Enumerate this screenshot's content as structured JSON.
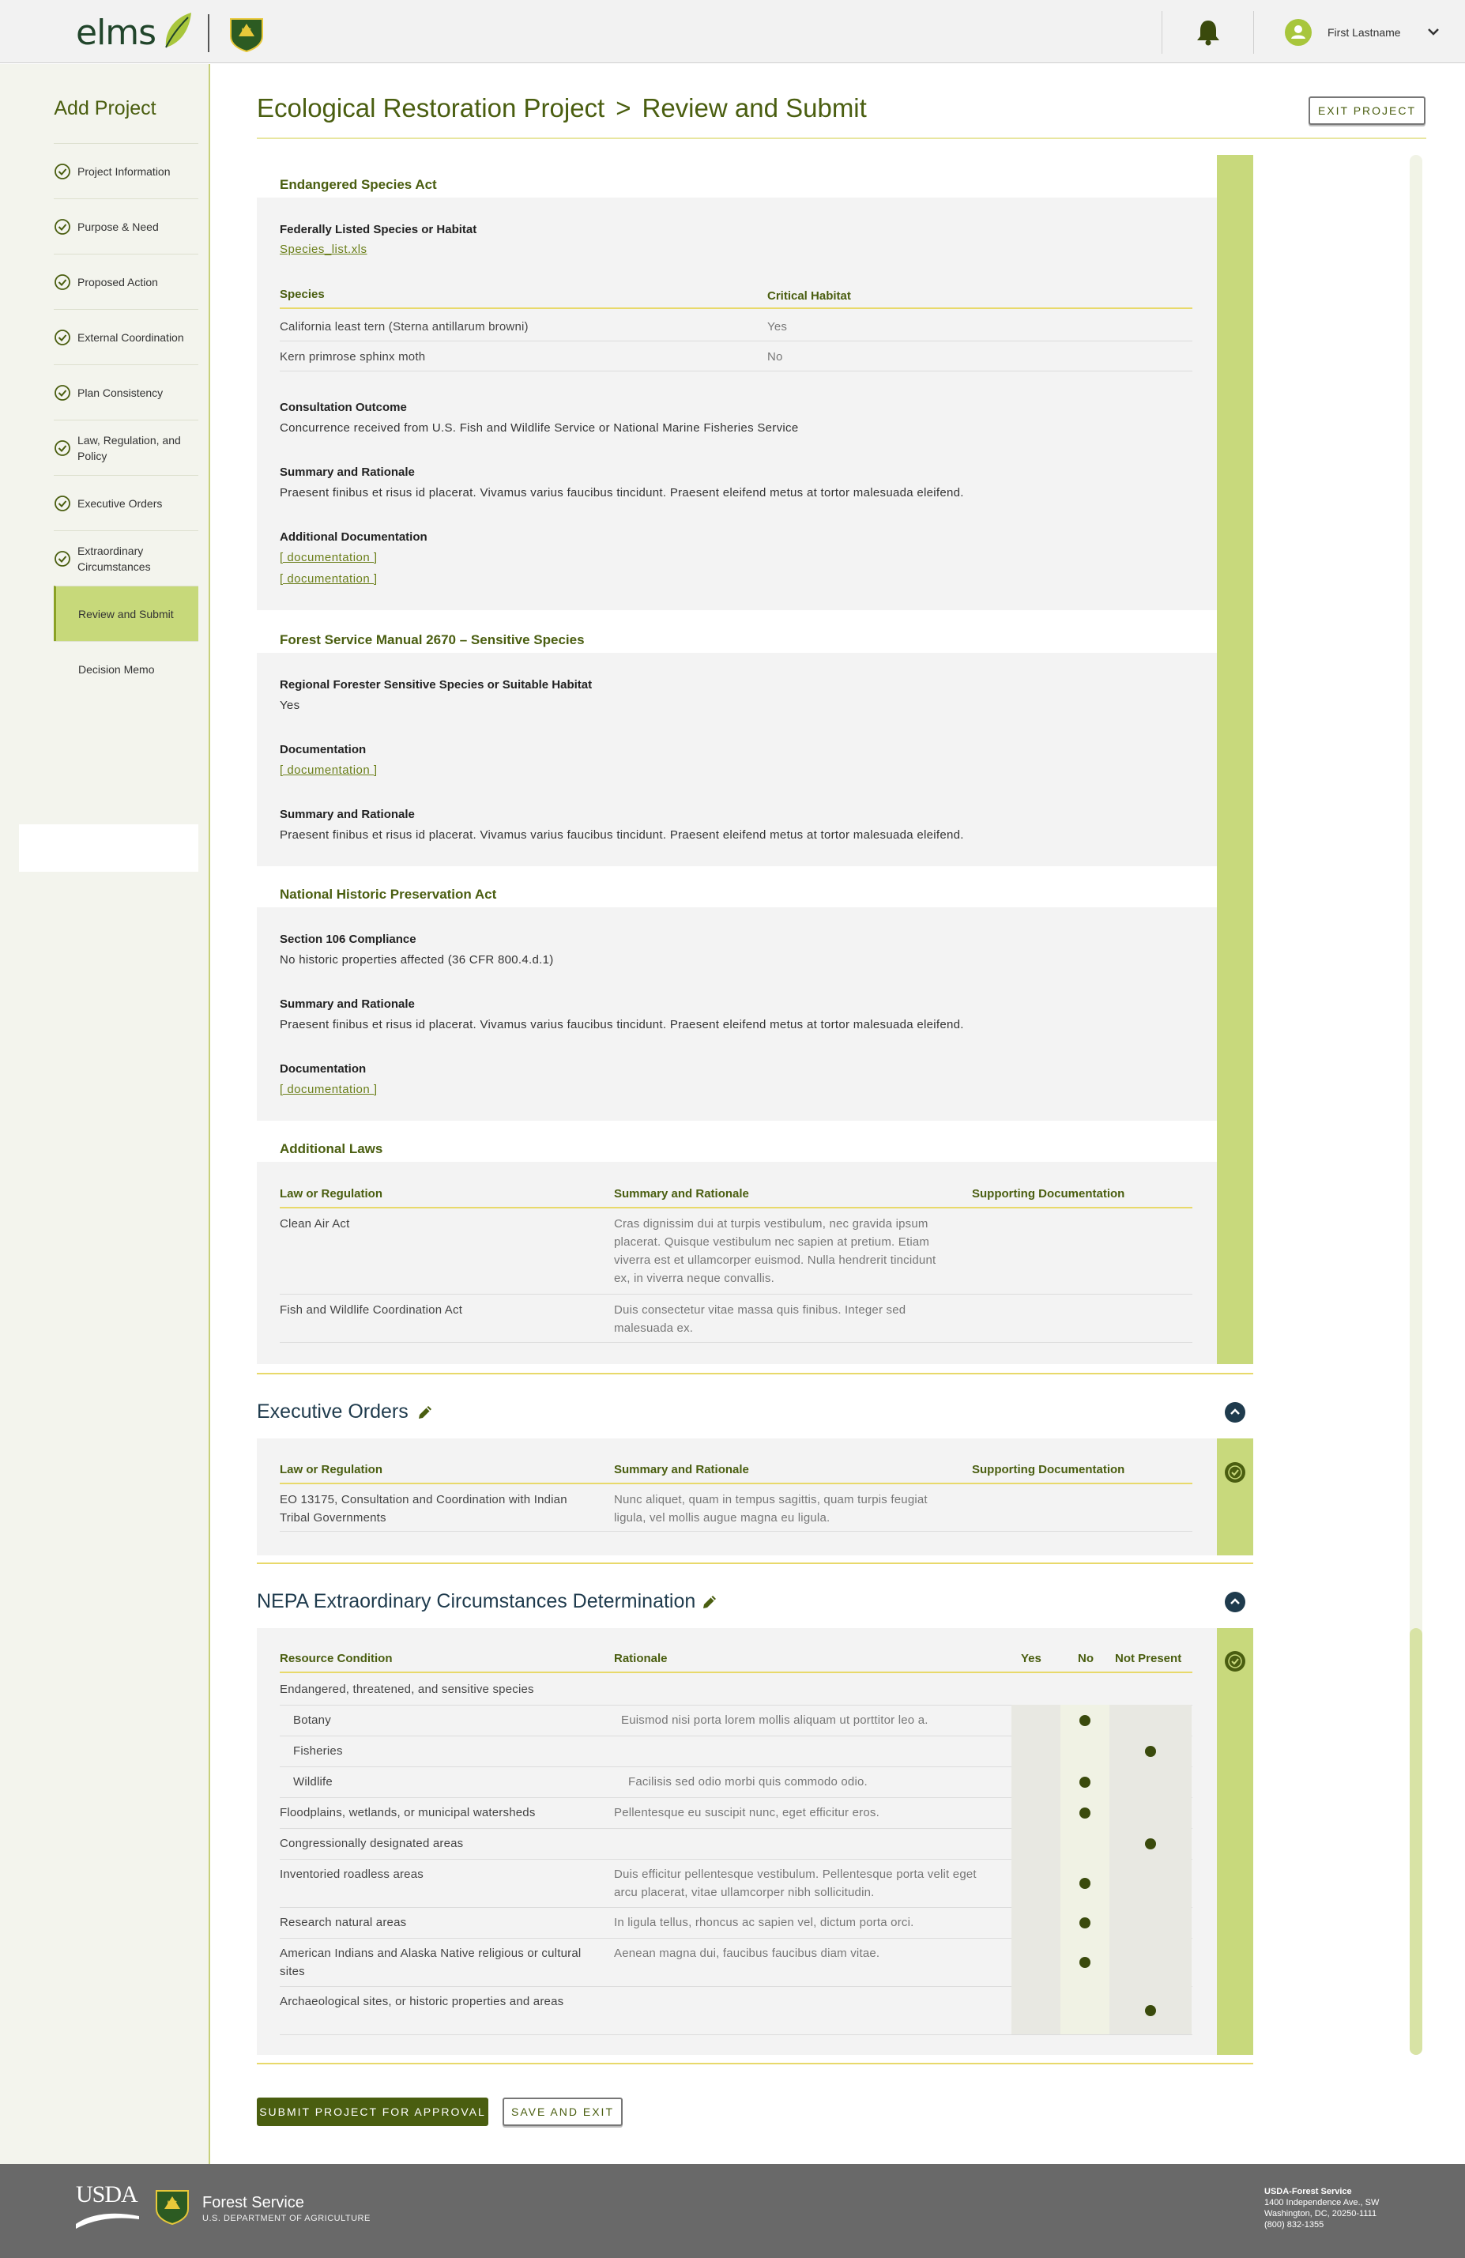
{
  "header": {
    "logo_text": "elms",
    "user_name": "First Lastname"
  },
  "sidebar": {
    "title": "Add Project",
    "items": [
      {
        "label": "Project Information",
        "done": true
      },
      {
        "label": "Purpose & Need",
        "done": true
      },
      {
        "label": "Proposed Action",
        "done": true
      },
      {
        "label": "External Coordination",
        "done": true
      },
      {
        "label": "Plan Consistency",
        "done": true
      },
      {
        "label": "Law, Regulation, and Policy",
        "done": true
      },
      {
        "label": "Executive Orders",
        "done": true
      },
      {
        "label": "Extraordinary Circumstances",
        "done": true
      },
      {
        "label": "Review and Submit",
        "done": false,
        "active": true
      },
      {
        "label": "Decision Memo",
        "done": false
      }
    ]
  },
  "page": {
    "project_name": "Ecological Restoration Project",
    "separator": ">",
    "step": "Review and Submit",
    "exit_label": "EXIT PROJECT"
  },
  "esa": {
    "heading": "Endangered Species Act",
    "listed_label": "Federally Listed Species or Habitat",
    "listed_file": "Species_list.xls",
    "col_species": "Species",
    "col_habitat": "Critical Habitat",
    "rows": [
      {
        "species": "California least tern (Sterna antillarum browni)",
        "habitat": "Yes"
      },
      {
        "species": "Kern primrose sphinx moth",
        "habitat": "No"
      }
    ],
    "outcome_label": "Consultation Outcome",
    "outcome_value": "Concurrence received from U.S. Fish and Wildlife Service or National Marine Fisheries Service",
    "summary_label": "Summary and Rationale",
    "summary_value": "Praesent finibus et risus id placerat. Vivamus varius faucibus tincidunt. Praesent eleifend metus at tortor malesuada eleifend.",
    "addl_label": "Additional Documentation",
    "doc1": "[ documentation ]",
    "doc2": "[ documentation ]"
  },
  "fsm": {
    "heading": "Forest Service Manual 2670 – Sensitive Species",
    "regional_label": "Regional Forester Sensitive Species or Suitable Habitat",
    "regional_value": "Yes",
    "doc_label": "Documentation",
    "doc_link": "[ documentation ]",
    "summary_label": "Summary and Rationale",
    "summary_value": "Praesent finibus et risus id placerat. Vivamus varius faucibus tincidunt. Praesent eleifend metus at tortor malesuada eleifend."
  },
  "nhpa": {
    "heading": "National Historic Preservation Act",
    "s106_label": "Section 106 Compliance",
    "s106_value": "No historic properties affected (36 CFR 800.4.d.1)",
    "summary_label": "Summary and Rationale",
    "summary_value": "Praesent finibus et risus id placerat. Vivamus varius faucibus tincidunt. Praesent eleifend metus at tortor malesuada eleifend.",
    "doc_label": "Documentation",
    "doc_link": "[ documentation ]"
  },
  "addl_laws": {
    "heading": "Additional Laws",
    "col_law": "Law or Regulation",
    "col_summary": "Summary and Rationale",
    "col_doc": "Supporting Documentation",
    "rows": [
      {
        "law": "Clean Air Act",
        "summary": "Cras dignissim dui at turpis vestibulum, nec gravida ipsum placerat. Quisque vestibulum nec sapien at pretium. Etiam viverra est et ullamcorper euismod. Nulla hendrerit tincidunt ex, in viverra neque convallis."
      },
      {
        "law": "Fish and Wildlife Coordination Act",
        "summary": "Duis consectetur vitae massa quis finibus. Integer sed malesuada ex."
      }
    ]
  },
  "exec_orders": {
    "title": "Executive Orders",
    "col_law": "Law or Regulation",
    "col_summary": "Summary and Rationale",
    "col_doc": "Supporting Documentation",
    "rows": [
      {
        "law": "EO 13175, Consultation and Coordination with Indian Tribal Governments",
        "summary": "Nunc aliquet, quam in tempus sagittis, quam turpis feugiat ligula, vel mollis augue magna eu ligula."
      }
    ]
  },
  "nepa": {
    "title": "NEPA Extraordinary Circumstances Determination",
    "col_resource": "Resource Condition",
    "col_rationale": "Rationale",
    "col_yes": "Yes",
    "col_no": "No",
    "col_np": "Not Present",
    "rows": [
      {
        "resource": "Endangered, threatened, and sensitive species",
        "rationale": "",
        "indent": false,
        "choice": ""
      },
      {
        "resource": "Botany",
        "rationale": "Euismod nisi porta lorem mollis aliquam ut porttitor leo a.",
        "indent": true,
        "choice": "no"
      },
      {
        "resource": "Fisheries",
        "rationale": "",
        "indent": true,
        "choice": "np"
      },
      {
        "resource": "Wildlife",
        "rationale": "Facilisis sed odio morbi quis commodo odio.",
        "indent": true,
        "choice": "no"
      },
      {
        "resource": "Floodplains, wetlands, or municipal watersheds",
        "rationale": "Pellentesque eu suscipit nunc, eget efficitur eros.",
        "indent": false,
        "choice": "no"
      },
      {
        "resource": "Congressionally designated areas",
        "rationale": "",
        "indent": false,
        "choice": "np"
      },
      {
        "resource": "Inventoried roadless areas",
        "rationale": "Duis efficitur pellentesque vestibulum. Pellentesque porta velit eget arcu placerat, vitae ullamcorper nibh sollicitudin.",
        "indent": false,
        "choice": "no"
      },
      {
        "resource": "Research natural areas",
        "rationale": "In ligula tellus, rhoncus ac sapien vel, dictum porta orci.",
        "indent": false,
        "choice": "no"
      },
      {
        "resource": "American Indians and Alaska Native religious or cultural sites",
        "rationale": "Aenean magna dui, faucibus faucibus diam vitae.",
        "indent": false,
        "choice": "no"
      },
      {
        "resource": "Archaeological sites, or historic properties and areas",
        "rationale": "",
        "indent": false,
        "choice": "np"
      }
    ]
  },
  "actions": {
    "submit_label": "SUBMIT PROJECT FOR APPROVAL",
    "save_label": "SAVE AND EXIT"
  },
  "footer": {
    "usda": "USDA",
    "agency": "Forest Service",
    "department": "U.S. DEPARTMENT OF AGRICULTURE",
    "addr_org": "USDA-Forest Service",
    "addr_line1": "1400 Independence Ave., SW",
    "addr_line2": "Washington, DC, 20250-1111",
    "addr_phone": "(800) 832-1355"
  },
  "colors": {
    "brand_green": "#4a5e10",
    "accent_lime": "#c8d97c",
    "navy": "#1f3b4d"
  }
}
